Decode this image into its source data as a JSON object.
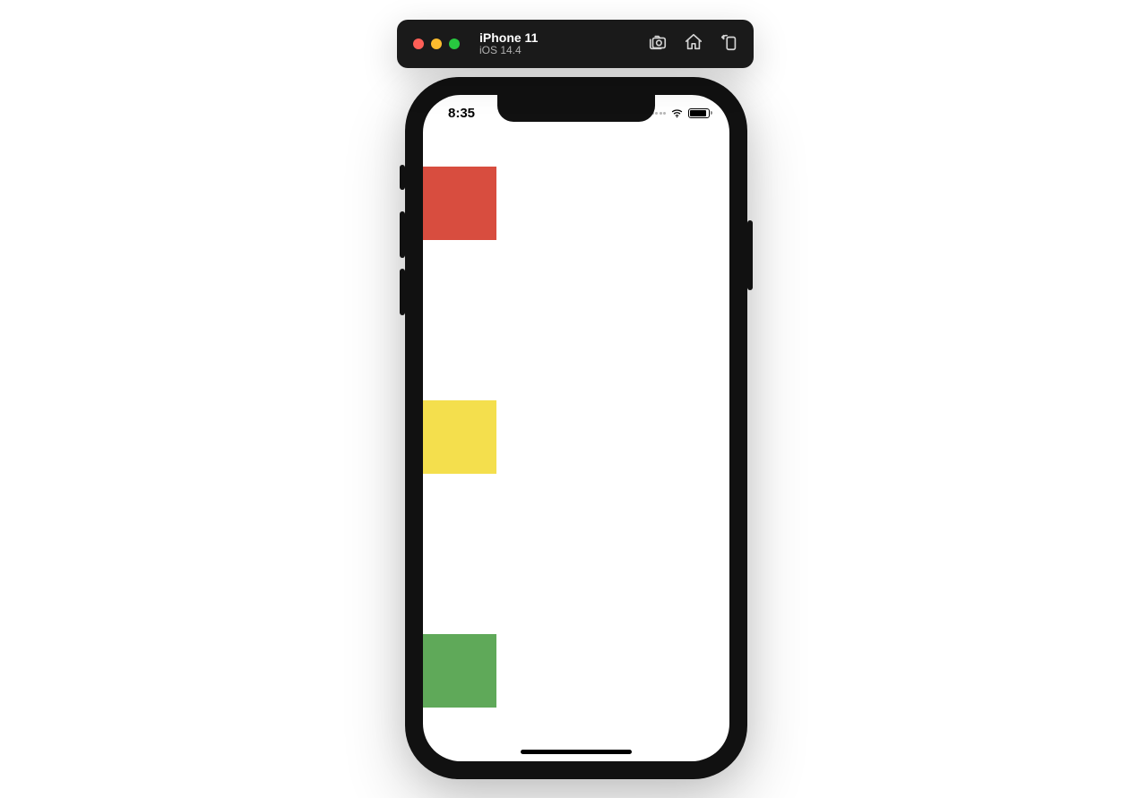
{
  "simulator": {
    "device_name": "iPhone 11",
    "os_version": "iOS 14.4",
    "traffic_light_colors": {
      "close": "#ff5f57",
      "minimize": "#febc2e",
      "zoom": "#28c840"
    },
    "actions": {
      "screenshot_icon": "screenshot-icon",
      "home_icon": "home-icon",
      "rotate_icon": "rotate-icon"
    }
  },
  "status_bar": {
    "time": "8:35",
    "battery_level_pct": 80
  },
  "app": {
    "boxes": [
      {
        "name": "red-box",
        "color": "#d84d3f"
      },
      {
        "name": "yellow-box",
        "color": "#f4df4d"
      },
      {
        "name": "green-box",
        "color": "#5fa959"
      }
    ]
  }
}
